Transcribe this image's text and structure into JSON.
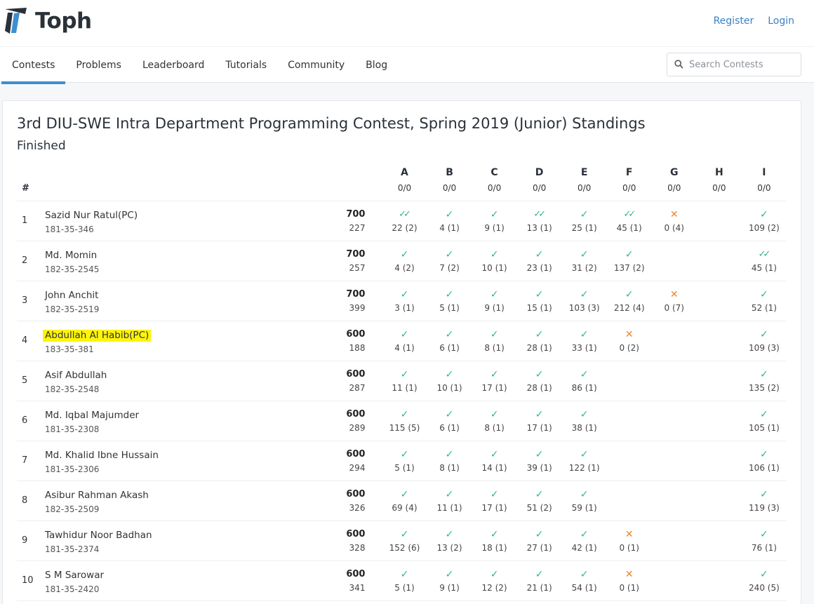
{
  "brand": {
    "name": "Toph"
  },
  "auth": {
    "register": "Register",
    "login": "Login"
  },
  "nav": [
    {
      "label": "Contests",
      "active": true
    },
    {
      "label": "Problems",
      "active": false
    },
    {
      "label": "Leaderboard",
      "active": false
    },
    {
      "label": "Tutorials",
      "active": false
    },
    {
      "label": "Community",
      "active": false
    },
    {
      "label": "Blog",
      "active": false
    }
  ],
  "search": {
    "placeholder": "Search Contests"
  },
  "page": {
    "title": "3rd DIU-SWE Intra Department Programming Contest, Spring 2019 (Junior) Standings",
    "status": "Finished"
  },
  "colors": {
    "accepted": "#2fb889",
    "rejected": "#e88830",
    "accent": "#3b8fd0",
    "highlight": "#fdf40a"
  },
  "table": {
    "rank_header": "#",
    "problems": [
      {
        "letter": "A",
        "count": "0/0"
      },
      {
        "letter": "B",
        "count": "0/0"
      },
      {
        "letter": "C",
        "count": "0/0"
      },
      {
        "letter": "D",
        "count": "0/0"
      },
      {
        "letter": "E",
        "count": "0/0"
      },
      {
        "letter": "F",
        "count": "0/0"
      },
      {
        "letter": "G",
        "count": "0/0"
      },
      {
        "letter": "H",
        "count": "0/0"
      },
      {
        "letter": "I",
        "count": "0/0"
      }
    ],
    "rows": [
      {
        "rank": "1",
        "name": "Sazid Nur Ratul(PC)",
        "id": "181-35-346",
        "score": "700",
        "penalty": "227",
        "highlight": false,
        "cells": [
          {
            "status": "first",
            "text": "22 (2)"
          },
          {
            "status": "ok",
            "text": "4 (1)"
          },
          {
            "status": "ok",
            "text": "9 (1)"
          },
          {
            "status": "first",
            "text": "13 (1)"
          },
          {
            "status": "ok",
            "text": "25 (1)"
          },
          {
            "status": "first",
            "text": "45 (1)"
          },
          {
            "status": "fail",
            "text": "0 (4)"
          },
          {
            "status": "none",
            "text": ""
          },
          {
            "status": "ok",
            "text": "109 (2)"
          }
        ]
      },
      {
        "rank": "2",
        "name": "Md. Momin",
        "id": "182-35-2545",
        "score": "700",
        "penalty": "257",
        "highlight": false,
        "cells": [
          {
            "status": "ok",
            "text": "4 (2)"
          },
          {
            "status": "ok",
            "text": "7 (2)"
          },
          {
            "status": "ok",
            "text": "10 (1)"
          },
          {
            "status": "ok",
            "text": "23 (1)"
          },
          {
            "status": "ok",
            "text": "31 (2)"
          },
          {
            "status": "ok",
            "text": "137 (2)"
          },
          {
            "status": "none",
            "text": ""
          },
          {
            "status": "none",
            "text": ""
          },
          {
            "status": "first",
            "text": "45 (1)"
          }
        ]
      },
      {
        "rank": "3",
        "name": "John Anchit",
        "id": "182-35-2519",
        "score": "700",
        "penalty": "399",
        "highlight": false,
        "cells": [
          {
            "status": "ok",
            "text": "3 (1)"
          },
          {
            "status": "ok",
            "text": "5 (1)"
          },
          {
            "status": "ok",
            "text": "9 (1)"
          },
          {
            "status": "ok",
            "text": "15 (1)"
          },
          {
            "status": "ok",
            "text": "103 (3)"
          },
          {
            "status": "ok",
            "text": "212 (4)"
          },
          {
            "status": "fail",
            "text": "0 (7)"
          },
          {
            "status": "none",
            "text": ""
          },
          {
            "status": "ok",
            "text": "52 (1)"
          }
        ]
      },
      {
        "rank": "4",
        "name": "Abdullah Al Habib(PC)",
        "id": "183-35-381",
        "score": "600",
        "penalty": "188",
        "highlight": true,
        "cells": [
          {
            "status": "ok",
            "text": "4 (1)"
          },
          {
            "status": "ok",
            "text": "6 (1)"
          },
          {
            "status": "ok",
            "text": "8 (1)"
          },
          {
            "status": "ok",
            "text": "28 (1)"
          },
          {
            "status": "ok",
            "text": "33 (1)"
          },
          {
            "status": "fail",
            "text": "0 (2)"
          },
          {
            "status": "none",
            "text": ""
          },
          {
            "status": "none",
            "text": ""
          },
          {
            "status": "ok",
            "text": "109 (3)"
          }
        ]
      },
      {
        "rank": "5",
        "name": "Asif Abdullah",
        "id": "182-35-2548",
        "score": "600",
        "penalty": "287",
        "highlight": false,
        "cells": [
          {
            "status": "ok",
            "text": "11 (1)"
          },
          {
            "status": "ok",
            "text": "10 (1)"
          },
          {
            "status": "ok",
            "text": "17 (1)"
          },
          {
            "status": "ok",
            "text": "28 (1)"
          },
          {
            "status": "ok",
            "text": "86 (1)"
          },
          {
            "status": "none",
            "text": ""
          },
          {
            "status": "none",
            "text": ""
          },
          {
            "status": "none",
            "text": ""
          },
          {
            "status": "ok",
            "text": "135 (2)"
          }
        ]
      },
      {
        "rank": "6",
        "name": "Md. Iqbal Majumder",
        "id": "181-35-2308",
        "score": "600",
        "penalty": "289",
        "highlight": false,
        "cells": [
          {
            "status": "ok",
            "text": "115 (5)"
          },
          {
            "status": "ok",
            "text": "6 (1)"
          },
          {
            "status": "ok",
            "text": "8 (1)"
          },
          {
            "status": "ok",
            "text": "17 (1)"
          },
          {
            "status": "ok",
            "text": "38 (1)"
          },
          {
            "status": "none",
            "text": ""
          },
          {
            "status": "none",
            "text": ""
          },
          {
            "status": "none",
            "text": ""
          },
          {
            "status": "ok",
            "text": "105 (1)"
          }
        ]
      },
      {
        "rank": "7",
        "name": "Md. Khalid Ibne Hussain",
        "id": "181-35-2306",
        "score": "600",
        "penalty": "294",
        "highlight": false,
        "cells": [
          {
            "status": "ok",
            "text": "5 (1)"
          },
          {
            "status": "ok",
            "text": "8 (1)"
          },
          {
            "status": "ok",
            "text": "14 (1)"
          },
          {
            "status": "ok",
            "text": "39 (1)"
          },
          {
            "status": "ok",
            "text": "122 (1)"
          },
          {
            "status": "none",
            "text": ""
          },
          {
            "status": "none",
            "text": ""
          },
          {
            "status": "none",
            "text": ""
          },
          {
            "status": "ok",
            "text": "106 (1)"
          }
        ]
      },
      {
        "rank": "8",
        "name": "Asibur Rahman Akash",
        "id": "182-35-2509",
        "score": "600",
        "penalty": "326",
        "highlight": false,
        "cells": [
          {
            "status": "ok",
            "text": "69 (4)"
          },
          {
            "status": "ok",
            "text": "11 (1)"
          },
          {
            "status": "ok",
            "text": "17 (1)"
          },
          {
            "status": "ok",
            "text": "51 (2)"
          },
          {
            "status": "ok",
            "text": "59 (1)"
          },
          {
            "status": "none",
            "text": ""
          },
          {
            "status": "none",
            "text": ""
          },
          {
            "status": "none",
            "text": ""
          },
          {
            "status": "ok",
            "text": "119 (3)"
          }
        ]
      },
      {
        "rank": "9",
        "name": "Tawhidur Noor Badhan",
        "id": "181-35-2374",
        "score": "600",
        "penalty": "328",
        "highlight": false,
        "cells": [
          {
            "status": "ok",
            "text": "152 (6)"
          },
          {
            "status": "ok",
            "text": "13 (2)"
          },
          {
            "status": "ok",
            "text": "18 (1)"
          },
          {
            "status": "ok",
            "text": "27 (1)"
          },
          {
            "status": "ok",
            "text": "42 (1)"
          },
          {
            "status": "fail",
            "text": "0 (1)"
          },
          {
            "status": "none",
            "text": ""
          },
          {
            "status": "none",
            "text": ""
          },
          {
            "status": "ok",
            "text": "76 (1)"
          }
        ]
      },
      {
        "rank": "10",
        "name": "S M Sarowar",
        "id": "181-35-2420",
        "score": "600",
        "penalty": "341",
        "highlight": false,
        "cells": [
          {
            "status": "ok",
            "text": "5 (1)"
          },
          {
            "status": "ok",
            "text": "9 (1)"
          },
          {
            "status": "ok",
            "text": "12 (2)"
          },
          {
            "status": "ok",
            "text": "21 (1)"
          },
          {
            "status": "ok",
            "text": "54 (1)"
          },
          {
            "status": "fail",
            "text": "0 (1)"
          },
          {
            "status": "none",
            "text": ""
          },
          {
            "status": "none",
            "text": ""
          },
          {
            "status": "ok",
            "text": "240 (5)"
          }
        ]
      }
    ]
  }
}
